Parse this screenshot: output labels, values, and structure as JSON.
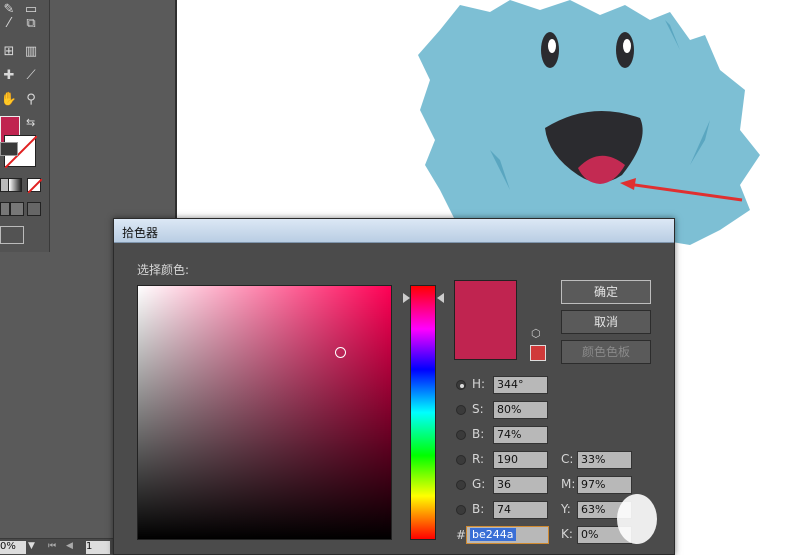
{
  "toolbar": {
    "tools": [
      "eyedropper",
      "measure",
      "bar-graph",
      "artboard",
      "slice",
      "hand",
      "zoom"
    ]
  },
  "statusbar": {
    "zoom": "0%",
    "page": "1"
  },
  "dialog": {
    "title": "拾色器",
    "select_label": "选择颜色:",
    "ok": "确定",
    "cancel": "取消",
    "swatches": "颜色色板",
    "current_color": "#c02450",
    "web_safe_color": "#d03a3a",
    "hsb": [
      {
        "label": "H:",
        "value": "344°",
        "selected": true
      },
      {
        "label": "S:",
        "value": "80%",
        "selected": false
      },
      {
        "label": "B:",
        "value": "74%",
        "selected": false
      }
    ],
    "rgb": [
      {
        "label": "R:",
        "value": "190"
      },
      {
        "label": "G:",
        "value": "36"
      },
      {
        "label": "B:",
        "value": "74"
      }
    ],
    "cmyk": [
      {
        "label": "C:",
        "value": "33%"
      },
      {
        "label": "M:",
        "value": "97%"
      },
      {
        "label": "Y:",
        "value": "63%"
      },
      {
        "label": "K:",
        "value": "0%"
      }
    ],
    "hex_label": "#",
    "hex_value": "be244a"
  },
  "colors": {
    "monster": "#7dbfd4",
    "monster_dark": "#5aa6c0",
    "mouth": "#2b2b2f",
    "tongue": "#c32a52",
    "arrow": "#e03030"
  }
}
